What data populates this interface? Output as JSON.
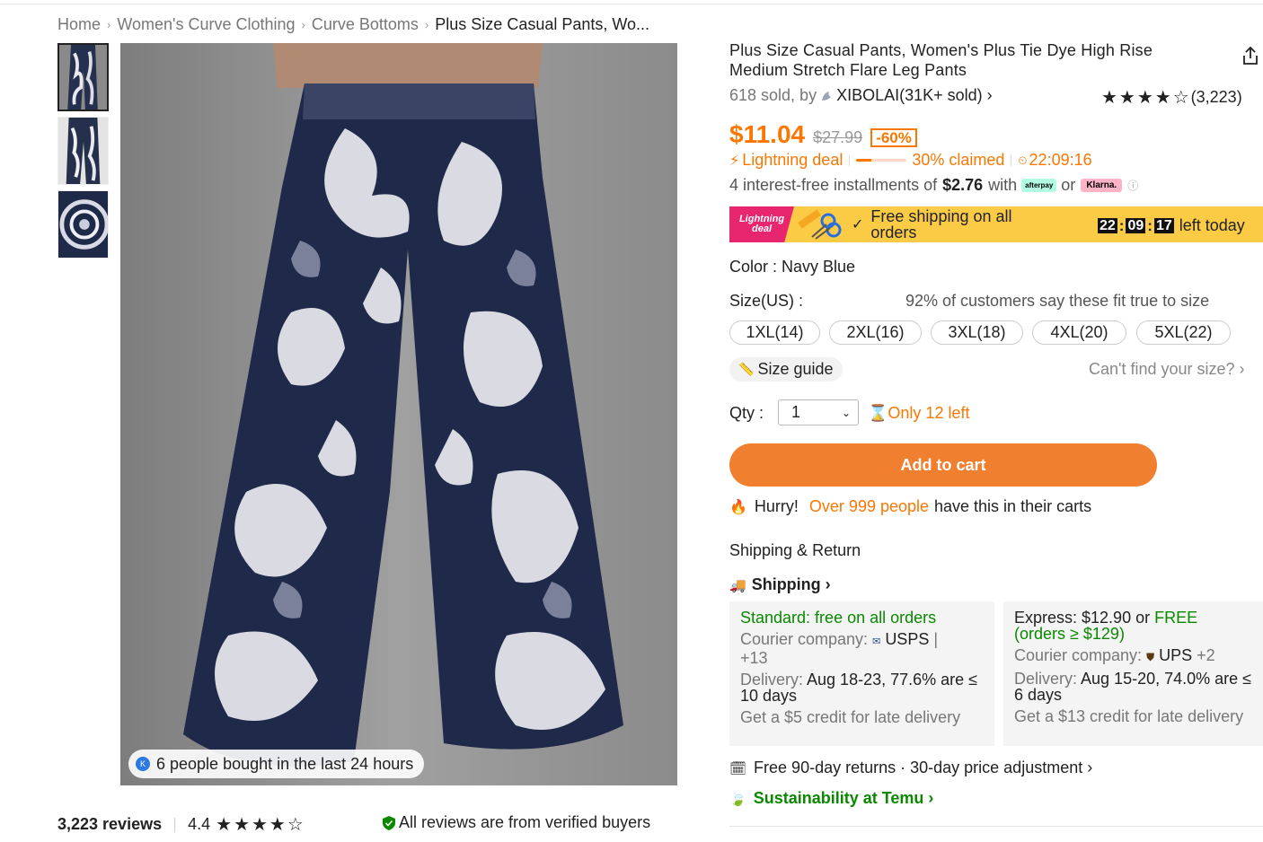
{
  "breadcrumb": [
    "Home",
    "Women's Curve Clothing",
    "Curve Bottoms",
    "Plus Size Casual Pants, Wo..."
  ],
  "product": {
    "title": "Plus Size Casual Pants, Women's Plus Tie Dye High Rise Medium Stretch Flare Leg Pants",
    "sold": "618 sold, by",
    "store": "XIBOLAI(31K+ sold) ›",
    "rating_stars": "★★★★☆",
    "rating_count": "(3,223)",
    "price": "$11.04",
    "old_price": "$27.99",
    "discount": "-60%"
  },
  "deal": {
    "label": "Lightning deal",
    "claimed_fraction": 0.3,
    "claimed": "30% claimed",
    "timer": "22:09:16"
  },
  "installments": {
    "prefix": "4 interest-free installments of",
    "amount": "$2.76",
    "with": "with",
    "afterpay": "afterpay",
    "or": "or",
    "klarna": "Klarna."
  },
  "banner": {
    "badge": "Lightning deal",
    "text": "Free shipping on all orders",
    "hh": "22",
    "mm": "09",
    "ss": "17",
    "suffix": "left today"
  },
  "options": {
    "color": "Color : Navy Blue",
    "size_label": "Size(US) :",
    "fit": "92% of customers say these fit true to size",
    "sizes": [
      "1XL(14)",
      "2XL(16)",
      "3XL(18)",
      "4XL(20)",
      "5XL(22)"
    ],
    "size_guide": "Size guide",
    "cant_find": "Can't find your size? ›"
  },
  "qty": {
    "label": "Qty :",
    "value": "1",
    "only_left": "Only 12 left"
  },
  "cart": {
    "add_label": "Add to cart",
    "hurry": "Hurry!",
    "people": "Over 999 people",
    "in_carts": "have this in their carts"
  },
  "shipping": {
    "section_title": "Shipping & Return",
    "link": "Shipping ›",
    "standard": {
      "title": "Standard: free on all orders",
      "courier_label": "Courier company:",
      "courier": "USPS",
      "extra": "+13",
      "delivery_label": "Delivery:",
      "delivery": "Aug 18-23, 77.6% are ≤ 10 days",
      "credit": "Get a $5 credit for late delivery"
    },
    "express": {
      "title_a": "Express: $12.90 or ",
      "title_b": "FREE (orders ≥ $129)",
      "courier_label": "Courier company:",
      "courier": "UPS",
      "extra": "+2",
      "delivery_label": "Delivery:",
      "delivery": "Aug 15-20, 74.0% are ≤ 6 days",
      "credit": "Get a $13 credit for late delivery"
    }
  },
  "returns": "Free 90-day returns · 30-day price adjustment ›",
  "sustainability": "Sustainability at Temu ›",
  "gallery": {
    "bought_badge": "6 people bought in the last 24 hours",
    "avatar_letter": "K"
  },
  "reviews": {
    "count": "3,223 reviews",
    "score": "4.4",
    "stars": "★★★★☆",
    "verified": "All reviews are from verified buyers"
  },
  "colors": {
    "accent": "#fb7701",
    "green": "#0a8800",
    "banner": "#fbcb46",
    "badge": "#e8256f"
  }
}
